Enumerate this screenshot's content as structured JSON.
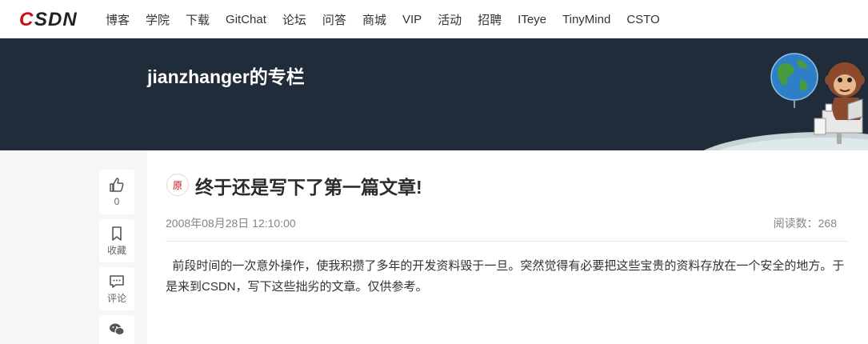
{
  "brand": {
    "logo_text": "CSDN",
    "accent": "#ca0c16"
  },
  "nav": {
    "items": [
      "博客",
      "学院",
      "下载",
      "GitChat",
      "论坛",
      "问答",
      "商城",
      "VIP",
      "活动",
      "招聘",
      "ITeye",
      "TinyMind",
      "CSTO"
    ]
  },
  "banner": {
    "title": "jianzhanger的专栏",
    "background": "#212c3a",
    "illustration": "monkey-with-globe-at-desk"
  },
  "rail": {
    "like": {
      "icon": "thumbs-up-icon",
      "count": "0"
    },
    "favorite": {
      "icon": "bookmark-icon",
      "label": "收藏"
    },
    "comment": {
      "icon": "comment-icon",
      "label": "评论"
    },
    "share": {
      "icon": "wechat-icon"
    }
  },
  "article": {
    "badge": "原",
    "title": "终于还是写下了第一篇文章!",
    "date": "2008年08月28日 12:10:00",
    "reads": "阅读数：268",
    "body": "  前段时间的一次意外操作，使我积攒了多年的开发资料毁于一旦。突然觉得有必要把这些宝贵的资料存放在一个安全的地方。于是来到CSDN，写下这些拙劣的文章。仅供参考。"
  }
}
